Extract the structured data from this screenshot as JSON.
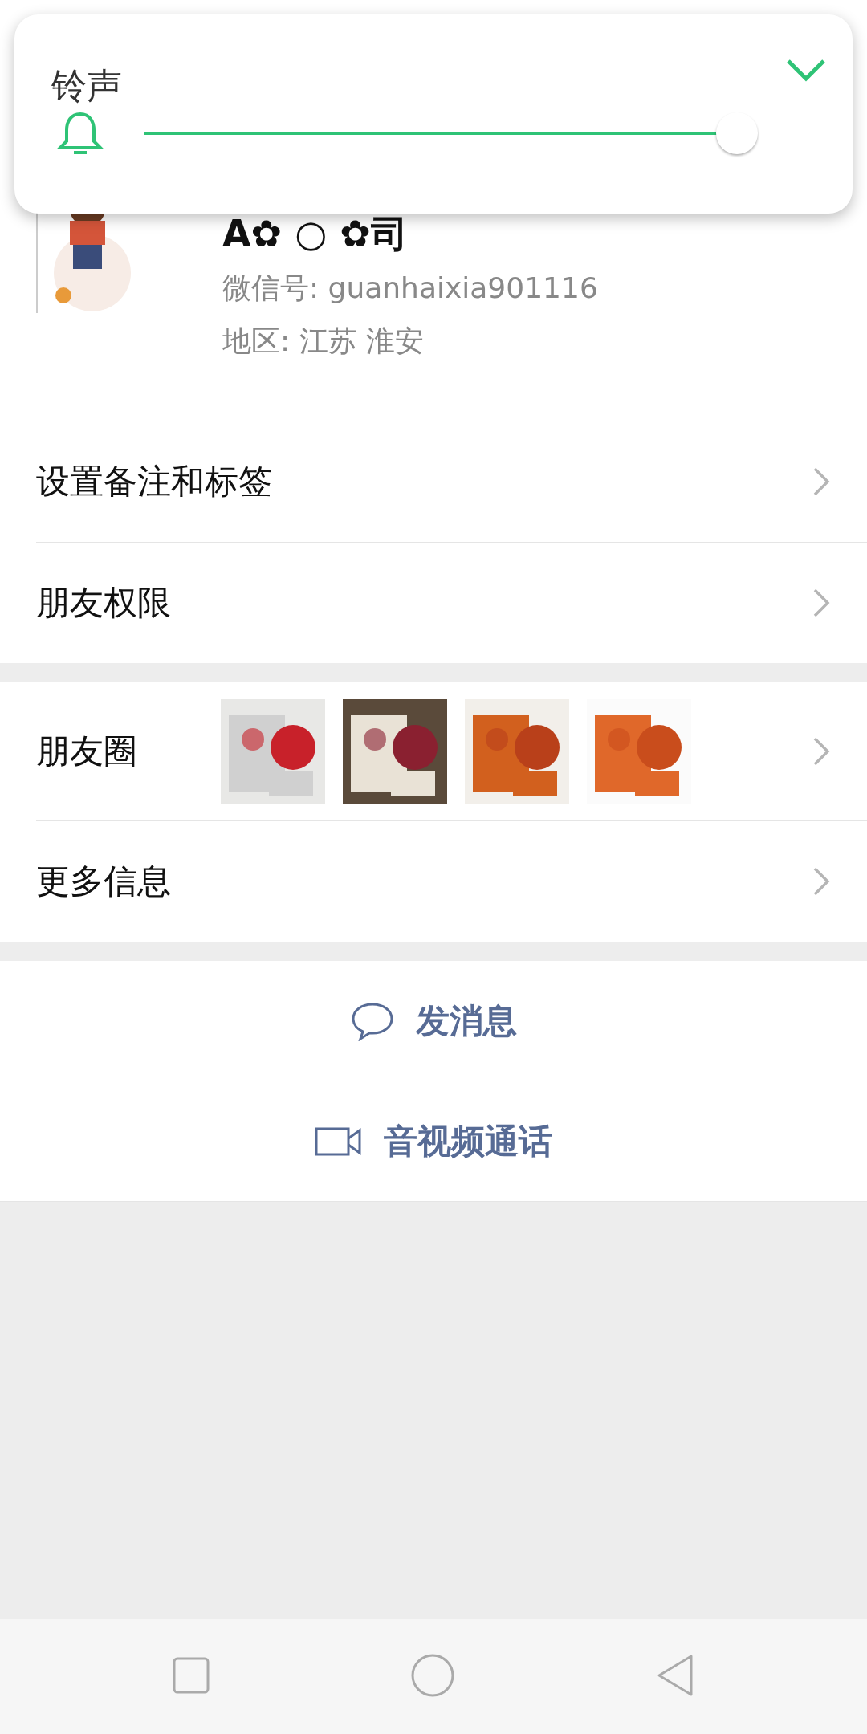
{
  "volume_panel": {
    "title": "铃声",
    "level": 0.97,
    "expanded": false
  },
  "profile": {
    "name": "A✿ ○ ✿司",
    "wechat_id": "微信号: guanhaixia901116",
    "region": "地区: 江苏  淮安"
  },
  "menu_groups": [
    [
      {
        "kind": "plain",
        "label": "设置备注和标签"
      },
      {
        "kind": "plain",
        "label": "朋友权限"
      }
    ],
    [
      {
        "kind": "moments",
        "label": "朋友圈"
      },
      {
        "kind": "plain",
        "label": "更多信息"
      }
    ]
  ],
  "actions": [
    {
      "kind": "message",
      "label": "发消息"
    },
    {
      "kind": "video",
      "label": "音视频通话"
    }
  ]
}
